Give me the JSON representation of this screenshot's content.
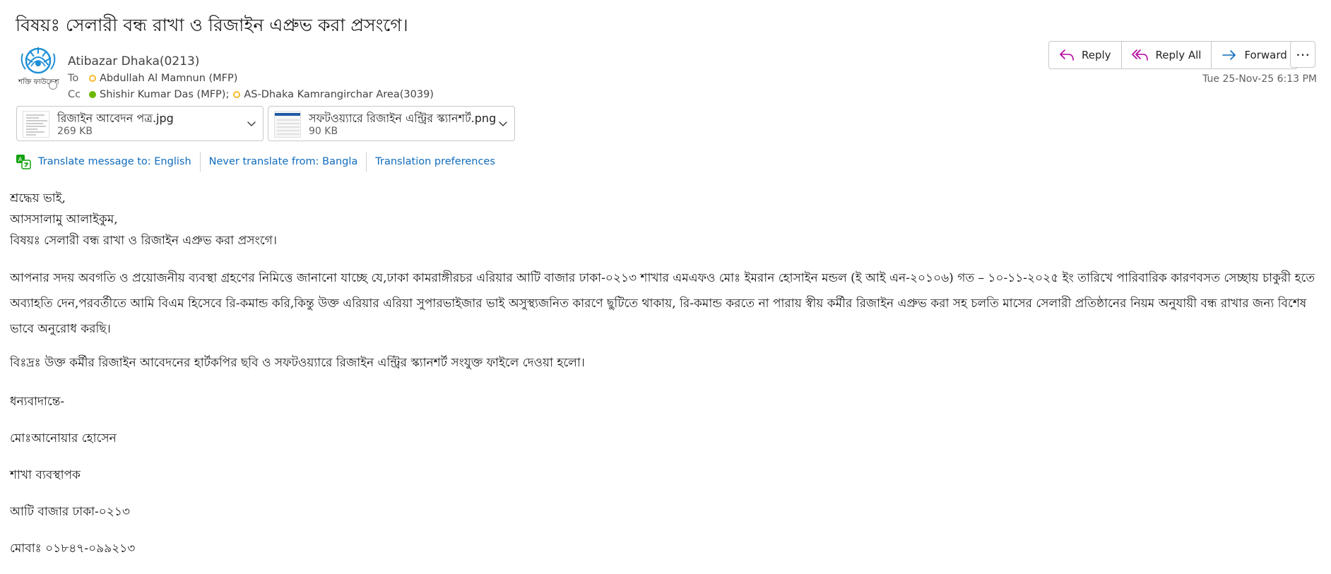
{
  "email": {
    "subject": "বিষয়ঃ সেলারী বন্ধ রাখা ও রিজাইন এপ্রুভ করা প্রসংগে।",
    "sender": "Atibazar Dhaka(0213)",
    "avatar_text": "শক্তি ফাউন্ডেশন",
    "to_label": "To",
    "to": [
      "Abdullah Al Mamnun (MFP)"
    ],
    "cc_label": "Cc",
    "cc": [
      "Shishir Kumar Das (MFP);",
      "AS-Dhaka Kamrangirchar Area(3039)"
    ],
    "date": "Tue 25-Nov-25 6:13 PM"
  },
  "actions": {
    "reply": "Reply",
    "reply_all": "Reply All",
    "forward": "Forward",
    "more": "⋯"
  },
  "attachments": [
    {
      "name": "রিজাইন আবেদন পত্র.jpg",
      "size": "269 KB"
    },
    {
      "name": "সফটওয়্যারে রিজাইন এন্ট্রির স্ক্যানশর্ট.png",
      "size": "90 KB"
    }
  ],
  "translation": {
    "translate": "Translate message to: English",
    "never": "Never translate from: Bangla",
    "prefs": "Translation preferences"
  },
  "body": {
    "greeting": "শ্রদ্ধেয় ভাই,",
    "salam": "আসসালামু আলাইকুম,",
    "subject_line": "বিষয়ঃ সেলারী বন্ধ রাখা ও রিজাইন এপ্রুভ করা প্রসংগে।",
    "paragraph1": "আপনার সদয় অবগতি ও প্রয়োজনীয় ব্যবস্থা গ্রহণের নিমিত্তে জানানো যাচ্ছে যে,ঢাকা কামরাঙ্গীরচর এরিয়ার  আটি বাজার ঢাকা-০২১৩ শাখার এমএফও মোঃ ইমরান হোসাইন মন্ডল (ই আই এন-২০১০৬) গত – ১০-১১-২০২৫ ইং তারিখে পারিবারিক কারণবসত সেচ্ছায় চাকুরী হতে অব্যাহতি দেন,পরবর্তীতে আমি বিএম হিসেবে  রি-কমান্ড করি,কিন্তু উক্ত এরিয়ার এরিয়া সুপারভাইজার ভাই অসুস্থ্যজনিত কারণে ছুটিতে থাকায়, রি-কমান্ড করতে না পারায় স্বীয় কর্মীর রিজাইন এপ্রুভ করা সহ চলতি মাসের সেলারী প্রতিষ্ঠানের নিয়ম অনুযায়ী  বন্ধ রাখার জন্য বিশেষ ভাবে অনুরোধ করছি।",
    "paragraph2": "বিঃদ্রঃ উক্ত কর্মীর রিজাইন আবেদনের হার্টকপির ছবি ও সফটওয়্যারে রিজাইন এন্ট্রির স্ক্যানশর্ট সংযুক্ত ফাইলে দেওয়া হলো।",
    "thanks": "ধন্যবাদান্তে-",
    "signature_name": "মোঃআনোয়ার হোসেন",
    "signature_title": "শাখা ব্যবস্থাপক",
    "signature_branch": "আটি বাজার ঢাকা-০২১৩",
    "signature_phone": "মোবাঃ ০১৮৪৭-০৯৯২১৩"
  },
  "colors": {
    "link": "#0f6cbd",
    "reply_icon": "#b4009e",
    "forward_icon": "#0f6cbd",
    "presence_away": "#f8b92b",
    "presence_available": "#6bb700"
  },
  "icons": {
    "reply": "reply-arrow-icon",
    "reply_all": "reply-all-arrow-icon",
    "forward": "forward-arrow-icon",
    "more": "more-horizontal-icon",
    "translate": "translate-icon",
    "attachment_menu": "chevron-down-icon"
  }
}
